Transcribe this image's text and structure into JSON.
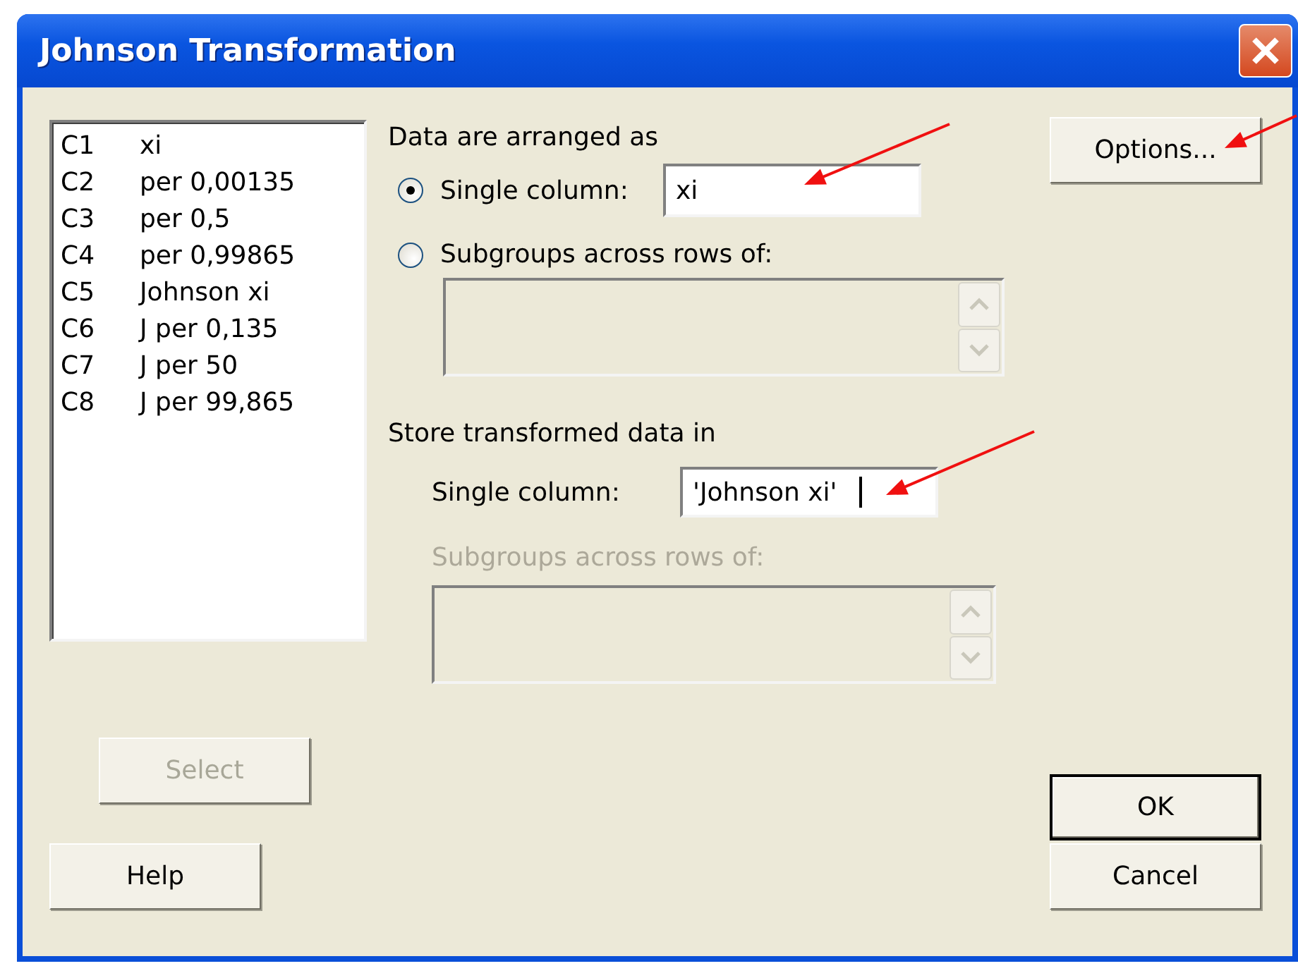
{
  "window": {
    "title": "Johnson Transformation"
  },
  "columns": [
    {
      "id": "C1",
      "name": "xi"
    },
    {
      "id": "C2",
      "name": "per 0,00135"
    },
    {
      "id": "C3",
      "name": "per 0,5"
    },
    {
      "id": "C4",
      "name": "per 0,99865"
    },
    {
      "id": "C5",
      "name": "Johnson xi"
    },
    {
      "id": "C6",
      "name": "J per 0,135"
    },
    {
      "id": "C7",
      "name": "J per 50"
    },
    {
      "id": "C8",
      "name": "J per 99,865"
    }
  ],
  "arrangement": {
    "heading": "Data are arranged as",
    "single_value": "xi",
    "options": [
      {
        "label": "Single column:",
        "selected": true
      },
      {
        "label": "Subgroups across rows of:",
        "selected": false
      }
    ]
  },
  "store": {
    "heading": "Store transformed data in",
    "single_label": "Single column:",
    "single_value": "'Johnson xi'",
    "subgroups_label": "Subgroups across rows of:",
    "subgroups_disabled": true
  },
  "left_buttons": [
    {
      "label": "Select",
      "disabled": true
    },
    {
      "label": "Help",
      "disabled": false
    }
  ],
  "right_buttons": [
    {
      "label": "Options...",
      "default": false
    },
    {
      "label": "OK",
      "default": true
    },
    {
      "label": "Cancel",
      "default": false
    }
  ]
}
